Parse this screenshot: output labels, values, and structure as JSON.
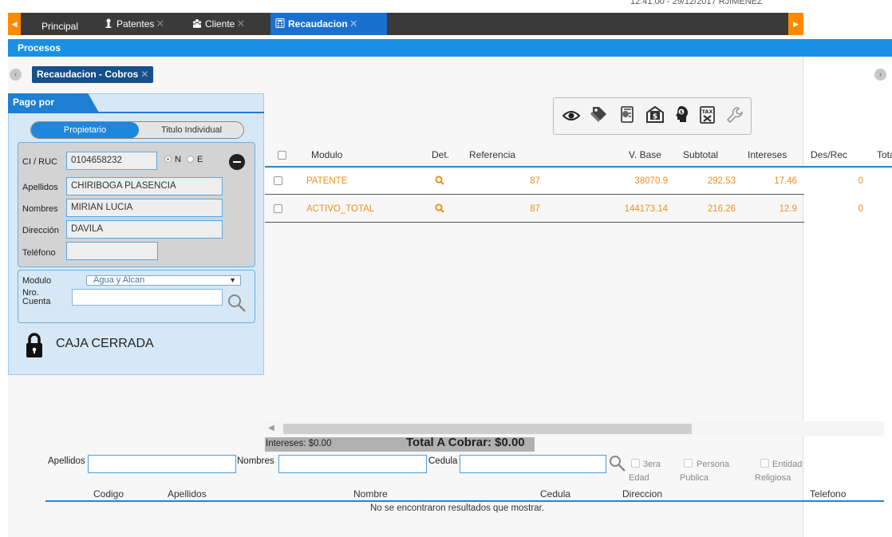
{
  "top_info": "12:41:00 - 29/12/2017 RJIMENEZ",
  "tabs": [
    {
      "label": "Principal"
    },
    {
      "label": "Patentes"
    },
    {
      "label": "Cliente"
    },
    {
      "label": "Recaudacion"
    }
  ],
  "procesos_label": "Procesos",
  "subtab_label": "Recaudacion - Cobros",
  "left": {
    "pago_tab": "Pago por",
    "toggle": {
      "left": "Propietario",
      "right": "Titulo Individual"
    },
    "fields": {
      "ci_label": "CI / RUC",
      "ci_value": "0104658232",
      "radio_n": "N",
      "radio_e": "E",
      "apellidos_label": "Apellidos",
      "apellidos_value": "CHIRIBOGA PLASENCIA",
      "nombres_label": "Nombres",
      "nombres_value": "MIRIAN LUCIA",
      "direccion_label": "Dirección",
      "direccion_value": "DAVILA",
      "telefono_label": "Teléfono",
      "telefono_value": ""
    },
    "modulo_label": "Modulo",
    "modulo_value": "Agua y Alcan",
    "cuenta_label_1": "Nro.",
    "cuenta_label_2": "Cuenta",
    "cuenta_value": "",
    "caja_status": "CAJA CERRADA"
  },
  "grid": {
    "headers": {
      "modulo": "Modulo",
      "det": "Det.",
      "referencia": "Referencia",
      "vbase": "V. Base",
      "subtotal": "Subtotal",
      "intereses": "Intereses",
      "desrec": "Des/Rec",
      "total": "Tota"
    },
    "rows": [
      {
        "modulo": "PATENTE",
        "referencia": "87",
        "vbase": "38070.9",
        "subtotal": "292.53",
        "intereses": "17.46",
        "desrec": "0"
      },
      {
        "modulo": "ACTIVO_TOTAL",
        "referencia": "87",
        "vbase": "144173.14",
        "subtotal": "216.26",
        "intereses": "12.9",
        "desrec": "0"
      }
    ]
  },
  "summary": {
    "intereses": "Intereses: $0.00",
    "total": "Total A Cobrar: $0.00"
  },
  "search": {
    "apellidos_label": "Apellidos",
    "nombres_label": "Nombres",
    "cedula_label": "Cedula",
    "apellidos_value": "",
    "nombres_value": "",
    "cedula_value": "",
    "chk_tercera_1": "3era",
    "chk_tercera_2": "Edad",
    "chk_persona_1": "Persona",
    "chk_persona_2": "Publica",
    "chk_entidad_1": "Entidad",
    "chk_entidad_2": "Religiosa"
  },
  "results": {
    "headers": {
      "codigo": "Codigo",
      "apellidos": "Apellidos",
      "nombre": "Nombre",
      "cedula": "Cedula",
      "direccion": "Direccion",
      "telefono": "Telefono"
    },
    "empty_message": "No se encontraron resultados que mostrar."
  },
  "colors": {
    "accent": "#1e86dd",
    "orange": "#f0901c",
    "tabbar": "#3a3a3a"
  }
}
